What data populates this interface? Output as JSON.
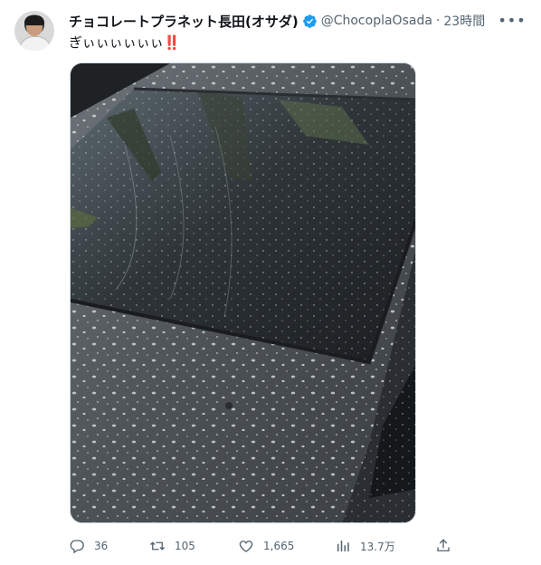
{
  "tweet": {
    "author_name": "チョコレートプラネット長田(オサダ)",
    "handle": "@ChocoplaOsada",
    "separator": "·",
    "time": "23時間",
    "text": "ぎぃぃぃぃぃぃ",
    "emoji_text": "‼️",
    "more_label": "•••"
  },
  "actions": {
    "replies": "36",
    "retweets": "105",
    "likes": "1,665",
    "views": "13.7万"
  },
  "icons": {
    "verified": "verified-badge-icon",
    "reply": "reply-icon",
    "retweet": "retweet-icon",
    "like": "heart-icon",
    "views": "views-icon",
    "share": "share-icon"
  },
  "colors": {
    "verified_blue": "#1d9bf0",
    "secondary_text": "#536471",
    "primary_text": "#0f1419"
  }
}
